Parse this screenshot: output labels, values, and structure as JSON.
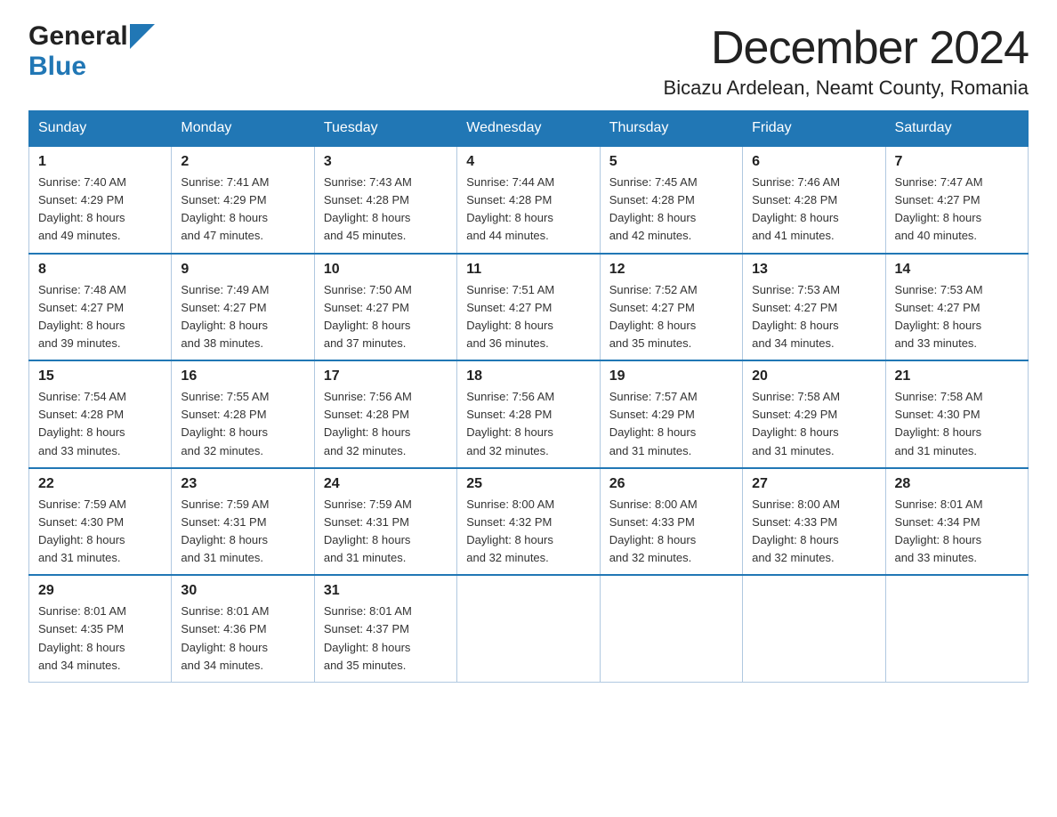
{
  "logo": {
    "general": "General",
    "blue": "Blue"
  },
  "header": {
    "month": "December 2024",
    "location": "Bicazu Ardelean, Neamt County, Romania"
  },
  "days": [
    "Sunday",
    "Monday",
    "Tuesday",
    "Wednesday",
    "Thursday",
    "Friday",
    "Saturday"
  ],
  "weeks": [
    [
      {
        "day": "1",
        "sunrise": "7:40 AM",
        "sunset": "4:29 PM",
        "daylight_h": "8",
        "daylight_m": "49"
      },
      {
        "day": "2",
        "sunrise": "7:41 AM",
        "sunset": "4:29 PM",
        "daylight_h": "8",
        "daylight_m": "47"
      },
      {
        "day": "3",
        "sunrise": "7:43 AM",
        "sunset": "4:28 PM",
        "daylight_h": "8",
        "daylight_m": "45"
      },
      {
        "day": "4",
        "sunrise": "7:44 AM",
        "sunset": "4:28 PM",
        "daylight_h": "8",
        "daylight_m": "44"
      },
      {
        "day": "5",
        "sunrise": "7:45 AM",
        "sunset": "4:28 PM",
        "daylight_h": "8",
        "daylight_m": "42"
      },
      {
        "day": "6",
        "sunrise": "7:46 AM",
        "sunset": "4:28 PM",
        "daylight_h": "8",
        "daylight_m": "41"
      },
      {
        "day": "7",
        "sunrise": "7:47 AM",
        "sunset": "4:27 PM",
        "daylight_h": "8",
        "daylight_m": "40"
      }
    ],
    [
      {
        "day": "8",
        "sunrise": "7:48 AM",
        "sunset": "4:27 PM",
        "daylight_h": "8",
        "daylight_m": "39"
      },
      {
        "day": "9",
        "sunrise": "7:49 AM",
        "sunset": "4:27 PM",
        "daylight_h": "8",
        "daylight_m": "38"
      },
      {
        "day": "10",
        "sunrise": "7:50 AM",
        "sunset": "4:27 PM",
        "daylight_h": "8",
        "daylight_m": "37"
      },
      {
        "day": "11",
        "sunrise": "7:51 AM",
        "sunset": "4:27 PM",
        "daylight_h": "8",
        "daylight_m": "36"
      },
      {
        "day": "12",
        "sunrise": "7:52 AM",
        "sunset": "4:27 PM",
        "daylight_h": "8",
        "daylight_m": "35"
      },
      {
        "day": "13",
        "sunrise": "7:53 AM",
        "sunset": "4:27 PM",
        "daylight_h": "8",
        "daylight_m": "34"
      },
      {
        "day": "14",
        "sunrise": "7:53 AM",
        "sunset": "4:27 PM",
        "daylight_h": "8",
        "daylight_m": "33"
      }
    ],
    [
      {
        "day": "15",
        "sunrise": "7:54 AM",
        "sunset": "4:28 PM",
        "daylight_h": "8",
        "daylight_m": "33"
      },
      {
        "day": "16",
        "sunrise": "7:55 AM",
        "sunset": "4:28 PM",
        "daylight_h": "8",
        "daylight_m": "32"
      },
      {
        "day": "17",
        "sunrise": "7:56 AM",
        "sunset": "4:28 PM",
        "daylight_h": "8",
        "daylight_m": "32"
      },
      {
        "day": "18",
        "sunrise": "7:56 AM",
        "sunset": "4:28 PM",
        "daylight_h": "8",
        "daylight_m": "32"
      },
      {
        "day": "19",
        "sunrise": "7:57 AM",
        "sunset": "4:29 PM",
        "daylight_h": "8",
        "daylight_m": "31"
      },
      {
        "day": "20",
        "sunrise": "7:58 AM",
        "sunset": "4:29 PM",
        "daylight_h": "8",
        "daylight_m": "31"
      },
      {
        "day": "21",
        "sunrise": "7:58 AM",
        "sunset": "4:30 PM",
        "daylight_h": "8",
        "daylight_m": "31"
      }
    ],
    [
      {
        "day": "22",
        "sunrise": "7:59 AM",
        "sunset": "4:30 PM",
        "daylight_h": "8",
        "daylight_m": "31"
      },
      {
        "day": "23",
        "sunrise": "7:59 AM",
        "sunset": "4:31 PM",
        "daylight_h": "8",
        "daylight_m": "31"
      },
      {
        "day": "24",
        "sunrise": "7:59 AM",
        "sunset": "4:31 PM",
        "daylight_h": "8",
        "daylight_m": "31"
      },
      {
        "day": "25",
        "sunrise": "8:00 AM",
        "sunset": "4:32 PM",
        "daylight_h": "8",
        "daylight_m": "32"
      },
      {
        "day": "26",
        "sunrise": "8:00 AM",
        "sunset": "4:33 PM",
        "daylight_h": "8",
        "daylight_m": "32"
      },
      {
        "day": "27",
        "sunrise": "8:00 AM",
        "sunset": "4:33 PM",
        "daylight_h": "8",
        "daylight_m": "32"
      },
      {
        "day": "28",
        "sunrise": "8:01 AM",
        "sunset": "4:34 PM",
        "daylight_h": "8",
        "daylight_m": "33"
      }
    ],
    [
      {
        "day": "29",
        "sunrise": "8:01 AM",
        "sunset": "4:35 PM",
        "daylight_h": "8",
        "daylight_m": "34"
      },
      {
        "day": "30",
        "sunrise": "8:01 AM",
        "sunset": "4:36 PM",
        "daylight_h": "8",
        "daylight_m": "34"
      },
      {
        "day": "31",
        "sunrise": "8:01 AM",
        "sunset": "4:37 PM",
        "daylight_h": "8",
        "daylight_m": "35"
      },
      null,
      null,
      null,
      null
    ]
  ]
}
